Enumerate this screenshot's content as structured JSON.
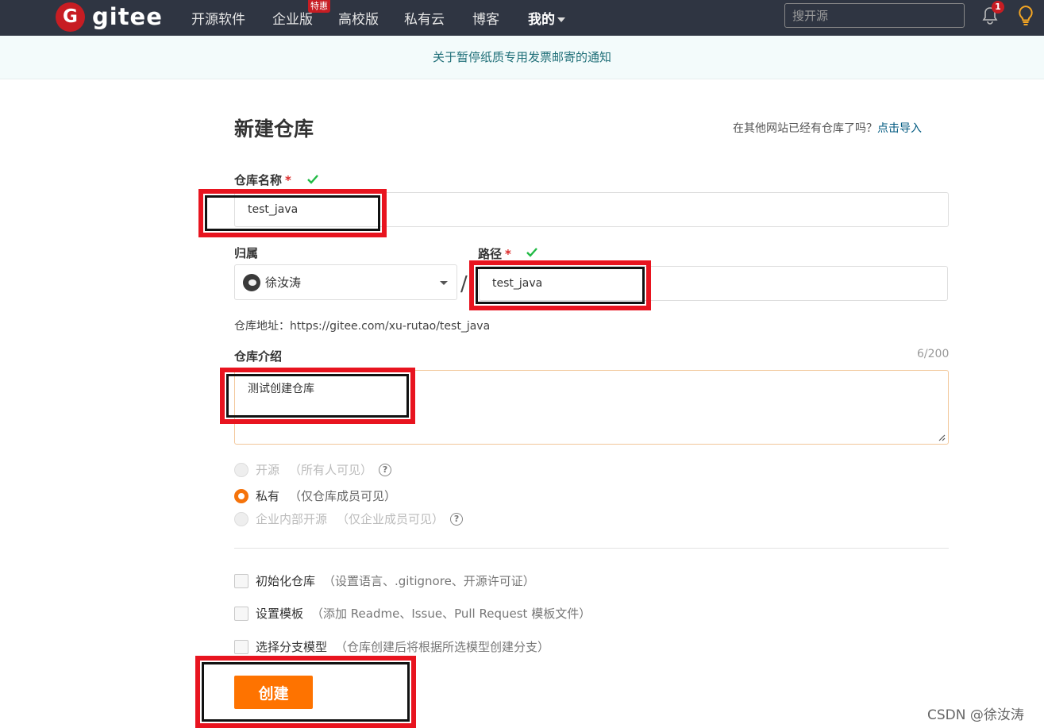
{
  "nav": {
    "brand": "gitee",
    "brand_icon": "G",
    "items": [
      "开源软件",
      "企业版",
      "高校版",
      "私有云",
      "博客",
      "我的"
    ],
    "promo_badge": "特惠",
    "search_placeholder": "搜开源",
    "notification_count": "1"
  },
  "notice": "关于暂停纸质专用发票邮寄的通知",
  "page": {
    "title": "新建仓库",
    "import_prompt": "在其他网站已经有仓库了吗？",
    "import_link": "点击导入"
  },
  "form": {
    "repo_name_label": "仓库名称",
    "repo_name_value": "test_java",
    "owner_label": "归属",
    "owner_name": "徐汝涛",
    "path_label": "路径",
    "path_value": "test_java",
    "required_mark": "*",
    "slash": "/",
    "repo_url": "仓库地址：https://gitee.com/xu-rutao/test_java",
    "intro_label": "仓库介绍",
    "intro_counter": "6/200",
    "intro_value": "测试创建仓库",
    "visibility": [
      {
        "label": "开源",
        "note": "（所有人可见）",
        "checked": false,
        "disabled": true,
        "help": true
      },
      {
        "label": "私有",
        "note": "（仅仓库成员可见）",
        "checked": true,
        "disabled": false,
        "help": false
      },
      {
        "label": "企业内部开源",
        "note": "（仅企业成员可见）",
        "checked": false,
        "disabled": true,
        "help": true
      }
    ],
    "options": [
      {
        "label": "初始化仓库",
        "note": "（设置语言、.gitignore、开源许可证）"
      },
      {
        "label": "设置模板",
        "note": "（添加 Readme、Issue、Pull Request 模板文件）"
      },
      {
        "label": "选择分支模型",
        "note": "（仓库创建后将根据所选模型创建分支）"
      }
    ],
    "help_glyph": "?",
    "submit_label": "创建"
  },
  "watermark": "CSDN @徐汝涛",
  "colors": {
    "nav_bg": "#2f3542",
    "brand_red": "#c71d23",
    "accent_orange": "#fe7300",
    "annotation_red": "#e8141f",
    "success_green": "#21ba45"
  }
}
